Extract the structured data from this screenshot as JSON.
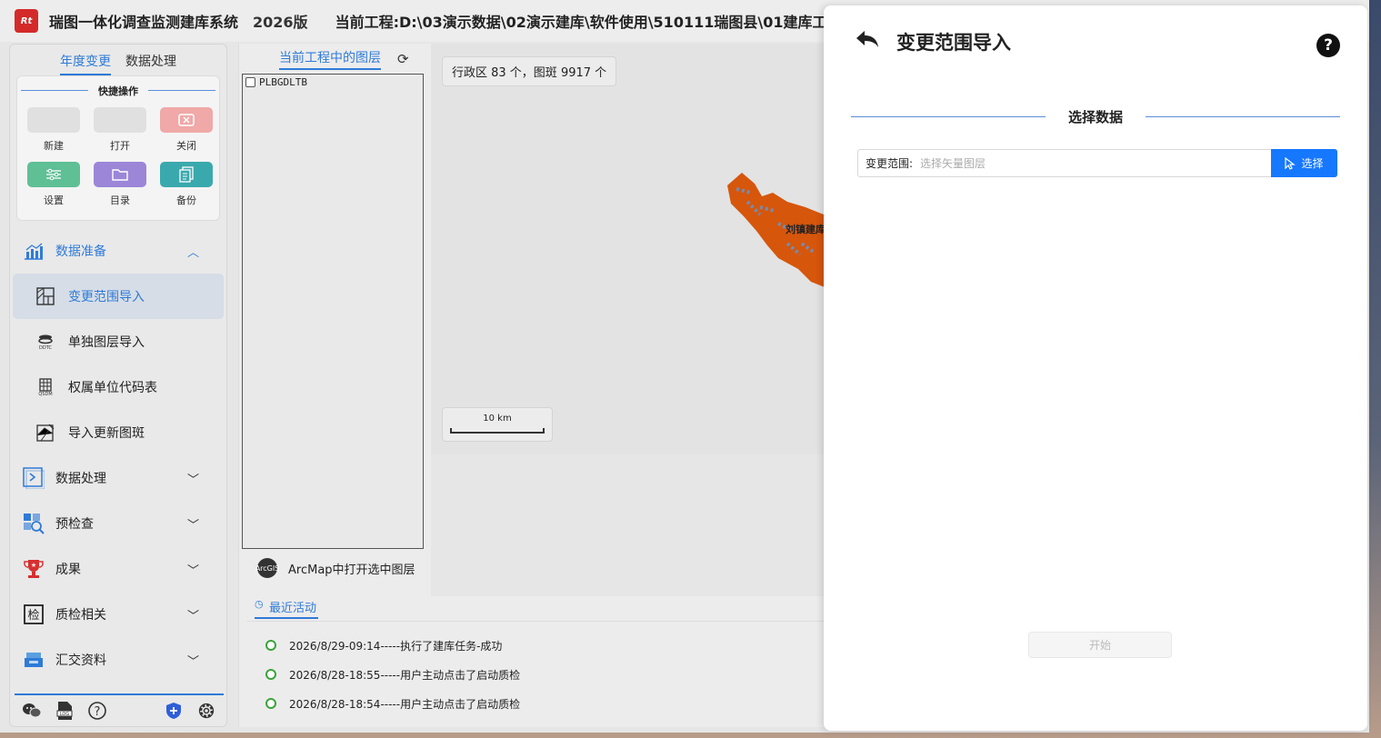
{
  "app": {
    "logo_text": "Rt",
    "title": "瑞图一体化调查监测建库系统",
    "version": "2026版",
    "project": "当前工程:D:\\03演示数据\\02演示建库\\软件使用\\510111瑞图县\\01建库工"
  },
  "sidebar": {
    "tabs": [
      "年度变更",
      "数据处理"
    ],
    "quick": {
      "title": "快捷操作",
      "items": [
        {
          "label": "新建",
          "icon": "new-icon"
        },
        {
          "label": "打开",
          "icon": "open-icon"
        },
        {
          "label": "关闭",
          "icon": "close-icon"
        },
        {
          "label": "设置",
          "icon": "settings-icon"
        },
        {
          "label": "目录",
          "icon": "folder-icon"
        },
        {
          "label": "备份",
          "icon": "backup-icon"
        }
      ]
    },
    "sections": {
      "prep": "数据准备",
      "process": "数据处理",
      "precheck": "预检查",
      "result": "成果",
      "qc": "质检相关",
      "submit": "汇交资料"
    },
    "prep_items": [
      "变更范围导入",
      "单独图层导入",
      "权属单位代码表",
      "导入更新图斑"
    ]
  },
  "layers": {
    "title": "当前工程中的图层",
    "items": [
      "PLBGDLTB"
    ],
    "arcmap_label": "ArcMap中打开选中图层",
    "arcgis_text": "ArcGIS"
  },
  "map": {
    "stats": "行政区 83 个，图斑 9917 个",
    "label": "刘镇建库",
    "scale": "10 km"
  },
  "activity": {
    "title": "最近活动",
    "items": [
      "2026/8/29-09:14-----执行了建库任务-成功",
      "2026/8/28-18:55-----用户主动点击了启动质检",
      "2026/8/28-18:54-----用户主动点击了启动质检"
    ]
  },
  "dialog": {
    "title": "变更范围导入",
    "section": "选择数据",
    "field_label": "变更范围:",
    "field_placeholder": "选择矢量图层",
    "select_label": "选择",
    "start_label": "开始"
  }
}
